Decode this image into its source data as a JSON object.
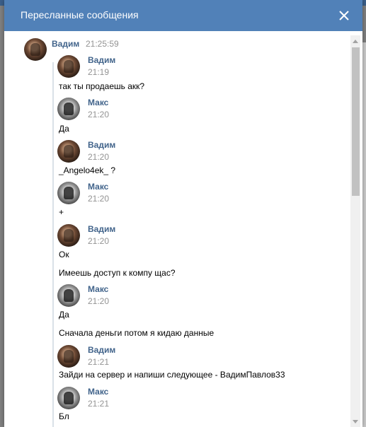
{
  "window": {
    "title": "Пересланные сообщения",
    "close_label": "×"
  },
  "thread": {
    "author": "Вадим",
    "time": "21:25:59"
  },
  "messages": [
    {
      "author": "Вадим",
      "time": "21:19",
      "avatar": "vadim",
      "lines": [
        "так ты продаешь акк?"
      ]
    },
    {
      "author": "Макс",
      "time": "21:20",
      "avatar": "maks",
      "lines": [
        "Да"
      ]
    },
    {
      "author": "Вадим",
      "time": "21:20",
      "avatar": "vadim",
      "lines": [
        "_Angelo4ek_ ?"
      ]
    },
    {
      "author": "Макс",
      "time": "21:20",
      "avatar": "maks",
      "lines": [
        "+"
      ]
    },
    {
      "author": "Вадим",
      "time": "21:20",
      "avatar": "vadim",
      "lines": [
        "Ок",
        "Имеешь доступ к компу щас?"
      ]
    },
    {
      "author": "Макс",
      "time": "21:20",
      "avatar": "maks",
      "lines": [
        "Да",
        "Сначала деньги потом я кидаю данные"
      ]
    },
    {
      "author": "Вадим",
      "time": "21:21",
      "avatar": "vadim",
      "lines": [
        "Зайди на сервер и напиши следующее - ВадимПавлов33"
      ]
    },
    {
      "author": "Макс",
      "time": "21:21",
      "avatar": "maks",
      "lines": [
        "Бл"
      ]
    }
  ],
  "colors": {
    "header_bg": "#5181b8",
    "author": "#42648b",
    "time": "#939393",
    "forward_line": "#dae1e8"
  }
}
